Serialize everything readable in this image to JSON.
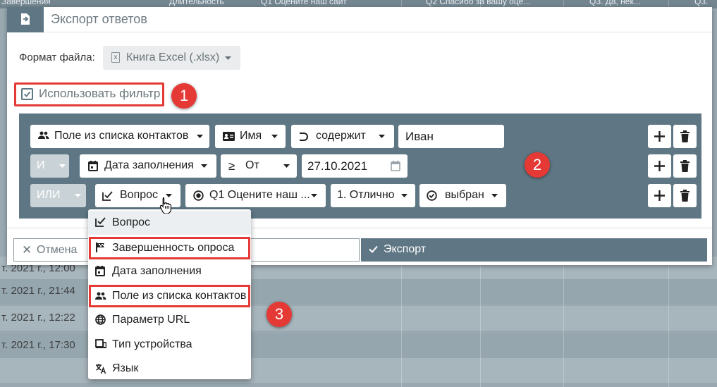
{
  "background": {
    "header_cols": [
      "Завершения",
      "Длительность",
      "Q1 Оцените наш сайт",
      "Q2 Спасибо за вашу оце...",
      "Q3. Да, нек...",
      "Q3."
    ],
    "rows": [
      "т. 2021 г., 12:00",
      "т. 2021 г., 21:44",
      "т. 2021 г., 12:22",
      "т. 2021 г., 17:30"
    ]
  },
  "dialog": {
    "title": "Экспорт ответов",
    "format_label": "Формат файла:",
    "format_value": "Книга Excel (.xlsx)",
    "use_filter_label": "Использовать фильтр",
    "use_filter_checked": true,
    "filters": [
      {
        "connector": "",
        "field": "Поле из списка контактов",
        "field_icon": "contacts-icon",
        "sub": "Имя",
        "sub_icon": "id-card-icon",
        "operator": "содержит",
        "operator_icon": "superset-icon",
        "value": "Иван"
      },
      {
        "connector": "И",
        "field": "Дата заполнения",
        "field_icon": "calendar-icon",
        "operator": "От",
        "operator_icon": "gte-icon",
        "value": "27.10.2021"
      },
      {
        "connector": "ИЛИ",
        "field": "Вопрос",
        "field_icon": "question-check-icon",
        "question": "Q1 Оцените наш ...",
        "question_icon": "radio-icon",
        "answer": "1. Отлично",
        "state": "выбран",
        "state_icon": "check-circle-icon"
      }
    ],
    "cancel_label": "Отмена",
    "export_label": "Экспорт"
  },
  "dropdown": {
    "items": [
      {
        "label": "Вопрос",
        "icon": "question-check-icon",
        "selected": true
      },
      {
        "label": "Завершенность опроса",
        "icon": "flag-icon",
        "highlighted": true
      },
      {
        "label": "Дата заполнения",
        "icon": "calendar-icon"
      },
      {
        "label": "Поле из списка контактов",
        "icon": "contacts-icon",
        "highlighted": true
      },
      {
        "label": "Параметр URL",
        "icon": "globe-icon"
      },
      {
        "label": "Тип устройства",
        "icon": "devices-icon"
      },
      {
        "label": "Язык",
        "icon": "translate-icon"
      }
    ]
  },
  "annotations": {
    "badge1": "1",
    "badge2": "2",
    "badge3": "3"
  },
  "colors": {
    "accent": "#5f7784",
    "highlight": "#e53935"
  }
}
